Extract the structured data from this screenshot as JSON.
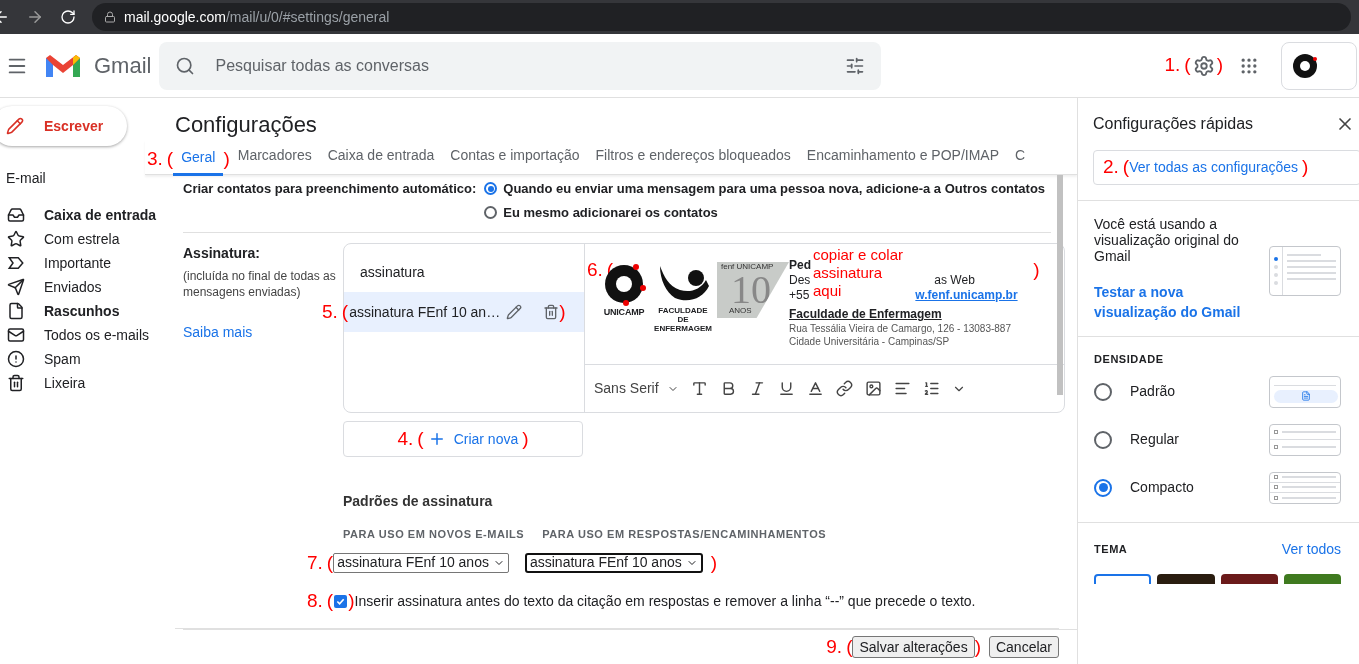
{
  "browser": {
    "host": "mail.google.com",
    "path": "/mail/u/0/#settings/general"
  },
  "header": {
    "app_name": "Gmail",
    "search": {
      "placeholder": "Pesquisar todas as conversas"
    },
    "annotation": {
      "number": "1.",
      "open": "(",
      "close": ")"
    }
  },
  "sidebar": {
    "compose": "Escrever",
    "section": "E-mail",
    "items": [
      {
        "kind": "inbox",
        "label": "Caixa de entrada",
        "unread": true
      },
      {
        "kind": "star",
        "label": "Com estrela",
        "unread": false
      },
      {
        "kind": "important",
        "label": "Importante",
        "unread": false
      },
      {
        "kind": "sent",
        "label": "Enviados",
        "unread": false
      },
      {
        "kind": "draft",
        "label": "Rascunhos",
        "unread": true
      },
      {
        "kind": "all",
        "label": "Todos os e-mails",
        "unread": false
      },
      {
        "kind": "spam",
        "label": "Spam",
        "unread": false
      },
      {
        "kind": "trash",
        "label": "Lixeira",
        "unread": false
      }
    ]
  },
  "settings": {
    "title": "Configurações",
    "tabs": [
      {
        "label": "Geral",
        "selected": true
      },
      {
        "label": "Marcadores",
        "selected": false
      },
      {
        "label": "Caixa de entrada",
        "selected": false
      },
      {
        "label": "Contas e importação",
        "selected": false
      },
      {
        "label": "Filtros e endereços bloqueados",
        "selected": false
      },
      {
        "label": "Encaminhamento e POP/IMAP",
        "selected": false
      },
      {
        "label": "C",
        "selected": false
      }
    ],
    "tabs_annotation": {
      "number": "3.",
      "open": "(",
      "close": ")"
    },
    "contacts": {
      "label": "Criar contatos para preenchimento automático:",
      "options": [
        {
          "label": "Quando eu enviar uma mensagem para uma pessoa nova, adicione-a a Outros contatos",
          "selected": true
        },
        {
          "label": "Eu mesmo adicionarei os contatos",
          "selected": false
        }
      ]
    },
    "signature": {
      "label": "Assinatura:",
      "note": "(incluída no final de todas as mensagens enviadas)",
      "learn_more": "Saiba mais",
      "list": [
        {
          "name": "assinatura",
          "selected": false
        },
        {
          "name": "assinatura FEnf 10 an…",
          "selected": true
        }
      ],
      "list_annotation": {
        "number": "5.",
        "open": "(",
        "close": ")"
      },
      "editor": {
        "annotation": {
          "number": "6.",
          "open": "(",
          "close": ")"
        },
        "note": "copiar e colar assinatura aqui",
        "logos": {
          "unicamp": "UNICAMP",
          "faculty": "FACULDADE DE ENFERMAGEM",
          "years": "10",
          "years_caption": "ANOS",
          "years_side": "fenf UNICAMP"
        },
        "lines": [
          {
            "kind": "name",
            "text": "Ped"
          },
          {
            "kind": "split",
            "left": "Des",
            "right": "as Web"
          },
          {
            "kind": "link",
            "left": "+55",
            "right": "w.fenf.unicamp.br"
          },
          {
            "kind": "org",
            "text": "Faculdade de Enfermagem"
          },
          {
            "kind": "address",
            "text": "Rua Tessália Vieira de Camargo, 126 - 13083-887"
          },
          {
            "kind": "address",
            "text": "Cidade Universitária - Campinas/SP"
          }
        ],
        "font": "Sans Serif"
      },
      "create": "Criar nova",
      "create_annotation": {
        "number": "4.",
        "open": "(",
        "close": ")"
      },
      "defaults": {
        "title": "Padrões de assinatura",
        "new_label": "PARA USO EM NOVOS E-MAILS",
        "reply_label": "PARA USO EM RESPOSTAS/ENCAMINHAMENTOS",
        "new_value": "assinatura FEnf 10 anos",
        "reply_value": "assinatura FEnf 10 anos",
        "annotation": {
          "number": "7.",
          "open": "(",
          "close": ")"
        }
      },
      "insert_before": {
        "checked": true,
        "label": "Inserir assinatura antes do texto da citação em respostas e remover a linha “--” que precede o texto.",
        "annotation": {
          "number": "8.",
          "open": "(",
          "close": ")"
        }
      }
    },
    "buttons": {
      "save": "Salvar alterações",
      "cancel": "Cancelar",
      "annotation": {
        "number": "9.",
        "open": "(",
        "close": ")"
      }
    }
  },
  "quick": {
    "title": "Configurações rápidas",
    "see_all": "Ver todas as configurações",
    "see_all_annotation": {
      "number": "2.",
      "open": "(",
      "close": ")"
    },
    "view_text": "Você está usando a visualização original do Gmail",
    "try_new": "Testar a nova visualização do Gmail",
    "density_title": "DENSIDADE",
    "density": [
      {
        "label": "Padrão",
        "selected": false
      },
      {
        "label": "Regular",
        "selected": false
      },
      {
        "label": "Compacto",
        "selected": true
      }
    ],
    "theme_title": "TEMA",
    "theme_all": "Ver todos",
    "themes": [
      {
        "color": "#ffffff",
        "selected": true
      },
      {
        "color": "#2a1d10",
        "selected": false
      },
      {
        "color": "#6b1a1a",
        "selected": false
      },
      {
        "color": "#3f7a1f",
        "selected": false
      }
    ]
  }
}
